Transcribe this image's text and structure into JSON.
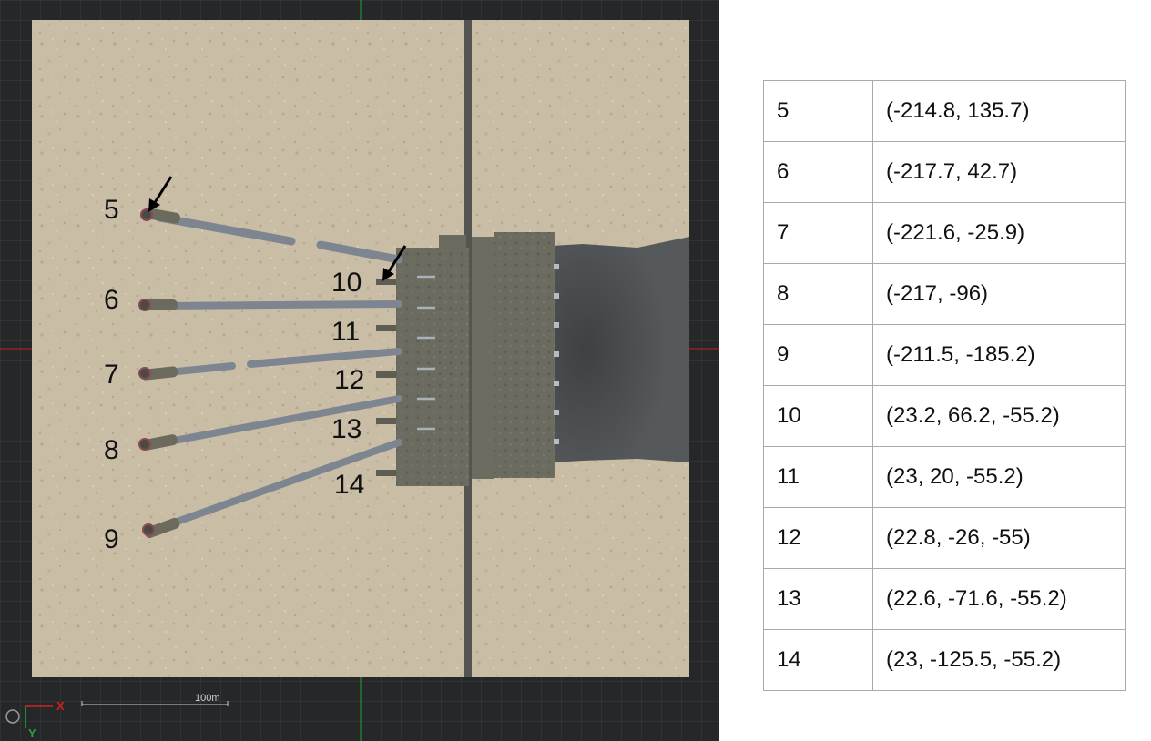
{
  "viewport": {
    "scale_bar_label": "100m",
    "axis_x_label": "X",
    "axis_y_label": "Y",
    "colors": {
      "grid_background": "#262728",
      "ground": "#c9bda6",
      "structure": "#6a6a5f",
      "tunnel": "#4c4f51",
      "pipe": "#7d8590",
      "axis_red": "#d42020",
      "axis_green": "#1ea83a"
    },
    "point_labels": [
      "5",
      "6",
      "7",
      "8",
      "9",
      "10",
      "11",
      "12",
      "13",
      "14"
    ]
  },
  "coordinates_table": {
    "rows": [
      {
        "id": "5",
        "coords": "(-214.8, 135.7)"
      },
      {
        "id": "6",
        "coords": "(-217.7, 42.7)"
      },
      {
        "id": "7",
        "coords": "(-221.6, -25.9)"
      },
      {
        "id": "8",
        "coords": "(-217, -96)"
      },
      {
        "id": "9",
        "coords": "(-211.5, -185.2)"
      },
      {
        "id": "10",
        "coords": "(23.2, 66.2, -55.2)"
      },
      {
        "id": "11",
        "coords": "(23, 20, -55.2)"
      },
      {
        "id": "12",
        "coords": "(22.8, -26, -55)"
      },
      {
        "id": "13",
        "coords": "(22.6, -71.6, -55.2)"
      },
      {
        "id": "14",
        "coords": "(23, -125.5, -55.2)"
      }
    ]
  }
}
